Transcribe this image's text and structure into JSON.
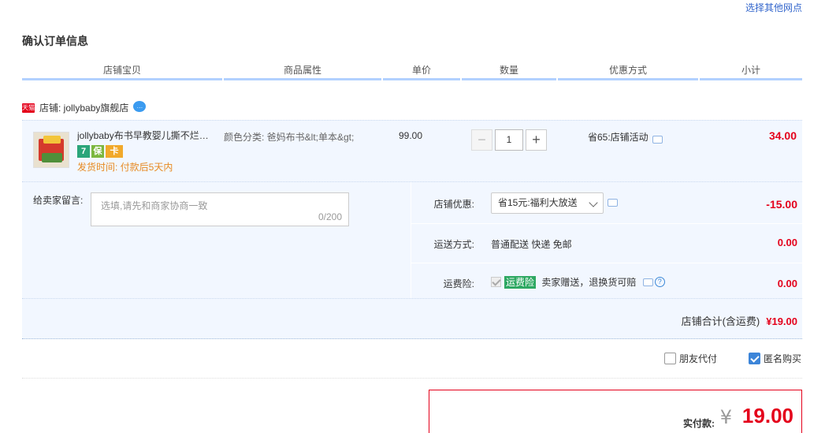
{
  "top_link": "选择其他网点",
  "page_title": "确认订单信息",
  "columns": [
    "店铺宝贝",
    "商品属性",
    "单价",
    "数量",
    "优惠方式",
    "小计"
  ],
  "shop": {
    "badge": "天猫",
    "label": "店铺: jollybaby旗舰店"
  },
  "item": {
    "title": "jollybaby布书早教婴儿撕不烂…",
    "service_icons": [
      "7",
      "保",
      "卡"
    ],
    "ship_time": "发货时间: 付款后5天内",
    "attributes": "颜色分类: 爸妈布书&lt;单本&gt;",
    "price": "99.00",
    "quantity": "1",
    "minus_label": "−",
    "plus_label": "+",
    "discount": "省65:店铺活动",
    "subtotal": "34.00"
  },
  "message": {
    "label": "给卖家留言:",
    "placeholder": "选填,请先和商家协商一致",
    "counter": "0/200"
  },
  "options": {
    "shop_discount_label": "店铺优惠:",
    "shop_discount_value": "省15元:福利大放送",
    "shop_discount_amount": "-15.00",
    "shipping_label": "运送方式:",
    "shipping_value": "普通配送 快递 免邮",
    "shipping_amount": "0.00",
    "insurance_label": "运费险:",
    "insurance_tag": "运费险",
    "insurance_text": "卖家赠送，退换货可赔",
    "insurance_amount": "0.00"
  },
  "shop_total": {
    "label": "店铺合计(含运费)",
    "amount": "¥19.00"
  },
  "checkboxes": {
    "friend_pay": "朋友代付",
    "anonymous": "匿名购买"
  },
  "payment": {
    "label": "实付款:",
    "currency": "¥",
    "amount": "19.00"
  },
  "colors": {
    "accent_red": "#e4001b",
    "row_bg": "#f2f7ff",
    "header_border": "#b2d1ff",
    "link_blue": "#3366cc"
  }
}
